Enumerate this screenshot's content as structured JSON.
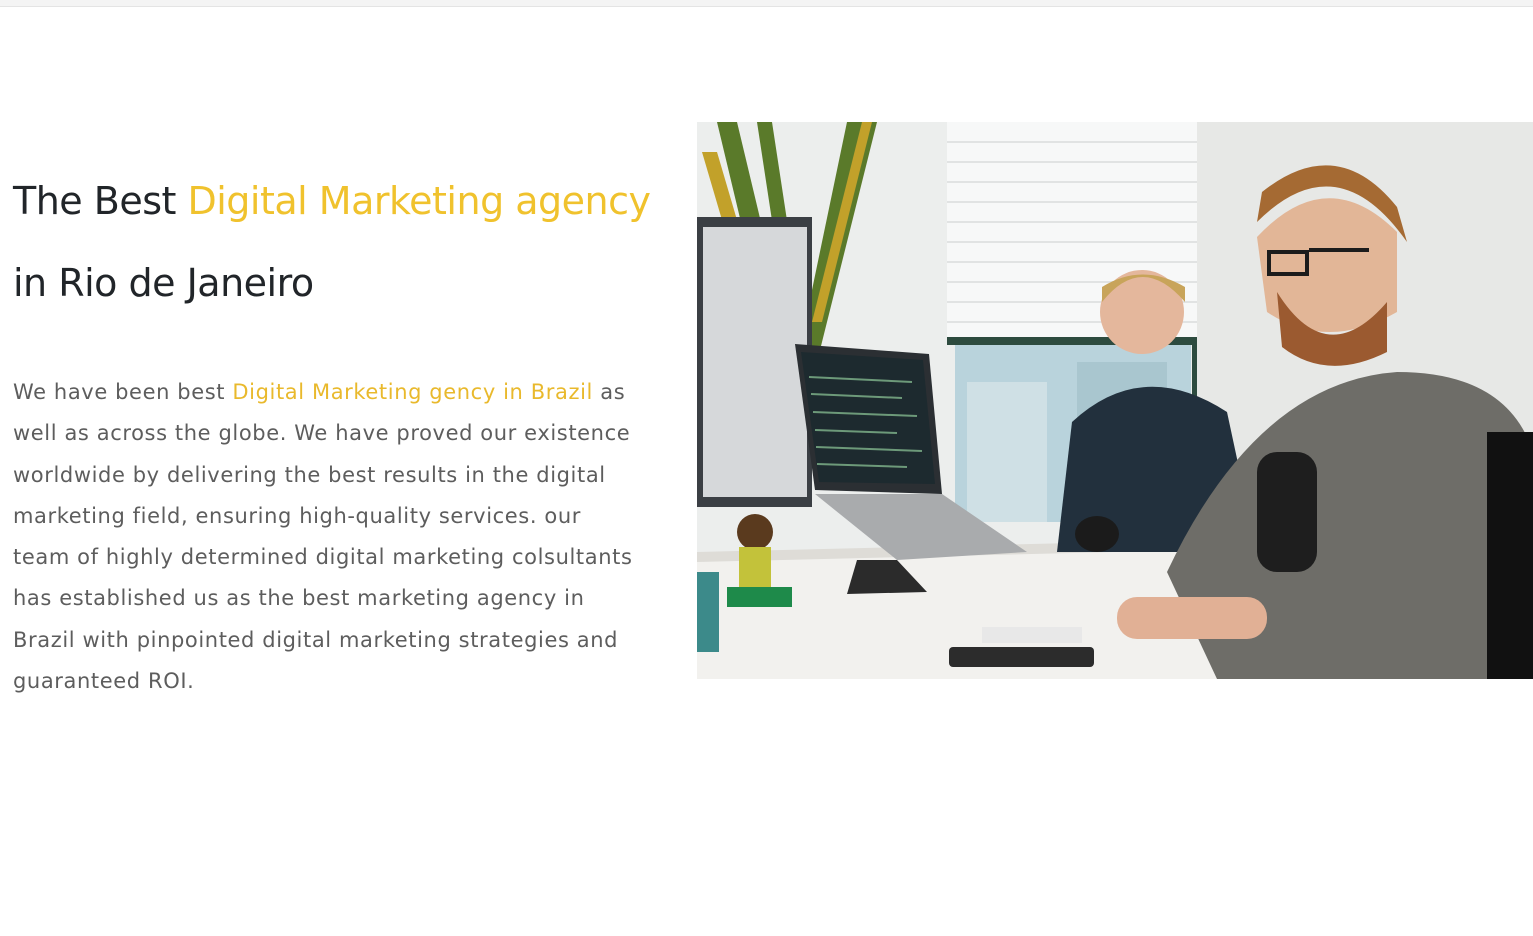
{
  "hero": {
    "headline_part1": "The Best ",
    "headline_accent1": "Digital Marketing agency",
    "headline_part2": " in Rio de Janeiro",
    "desc_part1": "We have been best ",
    "desc_accent": "Digital Marketing gency in Brazil",
    "desc_part2": " as well as across the globe. We have proved our existence worldwide by delivering the best results in the digital marketing field, ensuring high-quality services. our team of highly determined digital marketing colsultants has established us as the best marketing agency in Brazil with pinpointed digital marketing strategies and guaranteed ROI."
  },
  "photo": {
    "icon": "office-photo-icon",
    "accent_color": "#f0c22d"
  }
}
